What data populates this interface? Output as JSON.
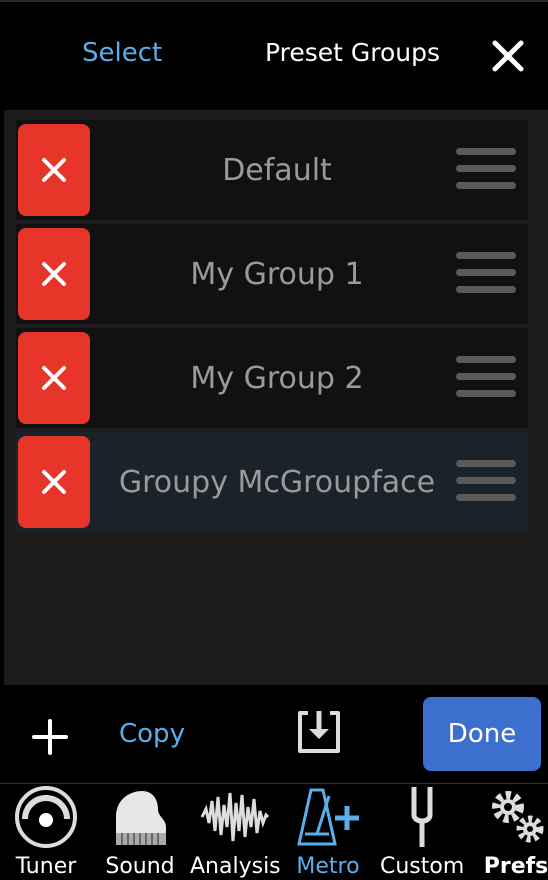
{
  "header": {
    "select_label": "Select",
    "title": "Preset Groups",
    "close_icon": "close-icon"
  },
  "groups": [
    {
      "name": "Default",
      "highlighted": false
    },
    {
      "name": "My Group 1",
      "highlighted": false
    },
    {
      "name": "My Group 2",
      "highlighted": false
    },
    {
      "name": "Groupy McGroupface",
      "highlighted": true
    }
  ],
  "toolbar": {
    "add_icon": "plus-icon",
    "copy_label": "Copy",
    "import_icon": "download-tray-icon",
    "done_label": "Done"
  },
  "tabs": [
    {
      "label": "Tuner",
      "icon": "tuner-dial-icon",
      "active": false
    },
    {
      "label": "Sound",
      "icon": "piano-icon",
      "active": false
    },
    {
      "label": "Analysis",
      "icon": "waveform-icon",
      "active": false
    },
    {
      "label": "Metro",
      "icon": "metronome-plus-icon",
      "active": true
    },
    {
      "label": "Custom",
      "icon": "tuning-fork-icon",
      "active": false
    },
    {
      "label": "Prefs",
      "icon": "gears-icon",
      "active": false
    }
  ],
  "colors": {
    "accent": "#5aaeea",
    "delete": "#e8352a",
    "done": "#3d6fcf",
    "highlight_row": "#1a222a"
  }
}
